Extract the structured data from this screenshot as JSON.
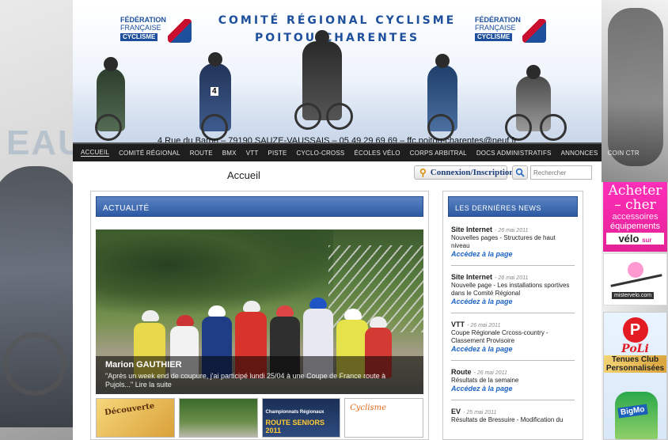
{
  "header": {
    "title_line1": "COMITÉ RÉGIONAL CYCLISME",
    "title_line2": "POITOU-CHARENTES",
    "logo_lines": [
      "FÉDÉRATION",
      "FRANÇAISE",
      "CYCLISME"
    ],
    "address": "4 Rue du Baron – 79190 SAUZE-VAUSSAIS – 05 49 29 69 69 – ffc.poitou-charentes@neuf.fr",
    "rider_number": "4"
  },
  "side_text": "EAU",
  "nav": {
    "items": [
      "Accueil",
      "Comité Régional",
      "Route",
      "BMX",
      "VTT",
      "Piste",
      "Cyclo-Cross",
      "Écoles Vélo",
      "Corps Arbitral",
      "Docs Administratifs",
      "Annonces",
      "Coin CTR"
    ]
  },
  "page_title": "Accueil",
  "login_label": "Connexion/Inscription",
  "search": {
    "placeholder": "Rechercher"
  },
  "actualite": {
    "header": "Actualité",
    "feature": {
      "name": "Marion GAUTHIER",
      "text": "\"Après un week end de coupure, j'ai participé lundi 25/04 à une Coupe de France route à Pujols...\" Lire la suite"
    },
    "thumbs": [
      {
        "label": "Découverte"
      },
      {
        "label": ""
      },
      {
        "line1": "Championnats Régionaux",
        "line2": "ROUTE SENIORS 2011"
      },
      {
        "label": "Cyclisme"
      }
    ]
  },
  "latest_news": {
    "header": "Les Dernières News",
    "items": [
      {
        "category": "Site Internet",
        "date": "- 26 mai 2011",
        "desc": "Nouvelles pages - Structures de haut niveau",
        "link": "Accédez à la page"
      },
      {
        "category": "Site Internet",
        "date": "- 26 mai 2011",
        "desc": "Nouvelle page - Les installations sportives dans le Comité Régional",
        "link": "Accédez à la page"
      },
      {
        "category": "VTT",
        "date": "- 26 mai 2011",
        "desc": "Coupe Régionale Crcoss-country - Classement Provisoire",
        "link": "Accédez à la page"
      },
      {
        "category": "Route",
        "date": "- 26 mai 2011",
        "desc": "Résultats de la semaine",
        "link": "Accédez à la page"
      },
      {
        "category": "EV",
        "date": "- 25 mai 2011",
        "desc": "Résultats de Bressuire - Modification du",
        "link": ""
      }
    ]
  },
  "ads": {
    "ad1": {
      "line1": "Acheter",
      "line2": "– cher",
      "line3": "accessoires",
      "line4": "équipements",
      "line5": "vélo",
      "line5b": "sur"
    },
    "ad2": {
      "label": "mistervelo.com"
    },
    "ad3": {
      "logo": "P",
      "brand": "PoLi",
      "line1": "Tenues Club",
      "line2": "Personnalisées",
      "jersey": "BigMo"
    }
  },
  "colors": {
    "accent_blue": "#2e5aa3",
    "nav_bg": "#1e1e1e",
    "link_blue": "#1c63c5",
    "ad_pink": "#e32196"
  }
}
